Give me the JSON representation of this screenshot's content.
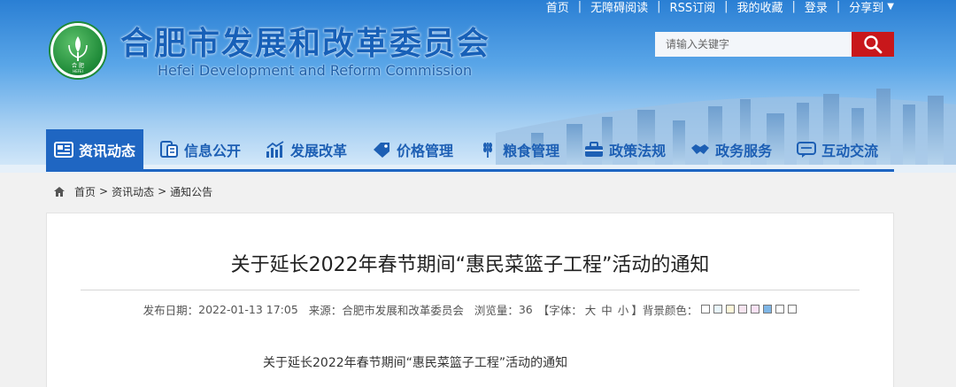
{
  "top_links": [
    "首页",
    "无障碍阅读",
    "RSS订阅",
    "我的收藏",
    "登录",
    "分享到"
  ],
  "site": {
    "title": "合肥市发展和改革委员会",
    "subtitle": "Hefei Development and Reform Commission",
    "logo_text_top": "合 肥",
    "logo_text_bottom": "HEFEI"
  },
  "search": {
    "placeholder": "请输入关键字",
    "icon": "search-icon"
  },
  "nav": [
    {
      "label": "资讯动态",
      "icon": "news-icon",
      "active": true
    },
    {
      "label": "信息公开",
      "icon": "info-icon"
    },
    {
      "label": "发展改革",
      "icon": "bar-chart-icon"
    },
    {
      "label": "价格管理",
      "icon": "price-tag-icon"
    },
    {
      "label": "粮食管理",
      "icon": "wheat-icon"
    },
    {
      "label": "政策法规",
      "icon": "briefcase-icon"
    },
    {
      "label": "政务服务",
      "icon": "handshake-icon"
    },
    {
      "label": "互动交流",
      "icon": "chat-icon"
    }
  ],
  "breadcrumb": [
    "首页",
    "资讯动态",
    "通知公告"
  ],
  "article": {
    "title": "关于延长2022年春节期间“惠民菜篮子工程”活动的通知",
    "meta": {
      "date_label": "发布日期：",
      "date": "2022-01-13 17:05",
      "source_label": "来源：",
      "source": "合肥市发展和改革委员会",
      "views_label": "浏览量：",
      "views": "36",
      "font_label_open": "【字体：",
      "font_sizes": [
        "大",
        "中",
        "小"
      ],
      "font_label_close": "】",
      "bg_label": "背景颜色："
    },
    "bg_colors": [
      "#ffffff",
      "#e8f5fb",
      "#fdf6d9",
      "#f6e4ef",
      "#f9e1f4",
      "#7fb6e6",
      "#ffffff",
      "#ffffff"
    ],
    "body_first_line": "关于延长2022年春节期间“惠民菜篮子工程”活动的通知"
  },
  "colors": {
    "nav_active": "#1f66c2",
    "search_button": "#c8171b",
    "title_blue": "#1760b8"
  }
}
